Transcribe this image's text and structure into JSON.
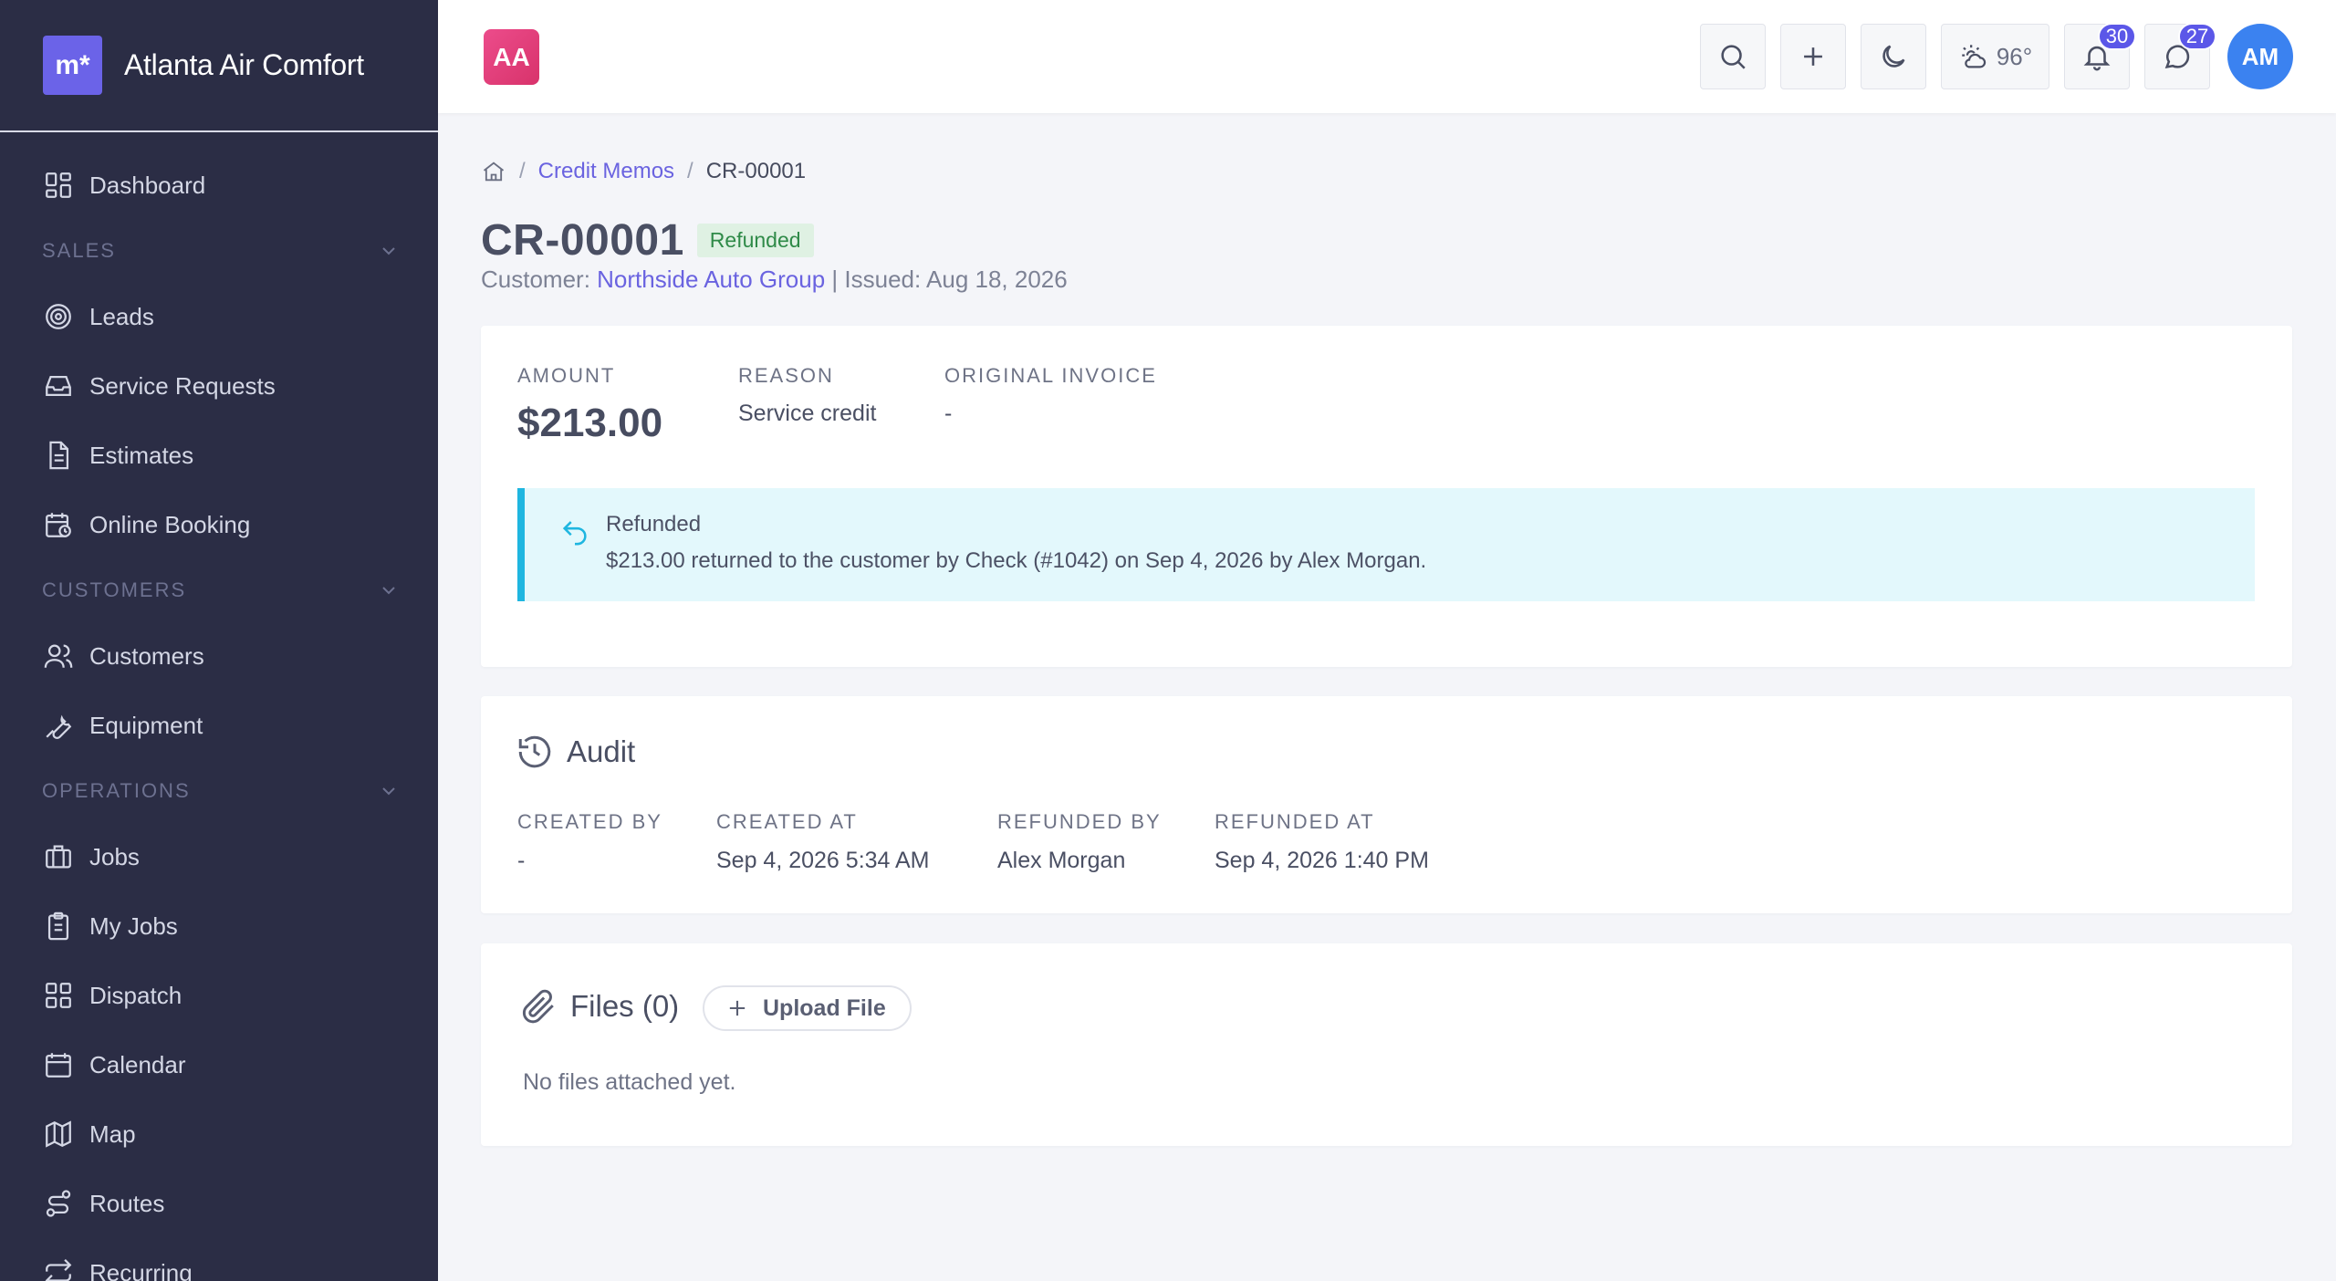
{
  "app": {
    "brand_mark": "m*",
    "company_name": "Atlanta Air Comfort",
    "company_initials": "AA"
  },
  "sidebar": {
    "items": [
      {
        "label": "Dashboard",
        "icon": "dashboard-icon"
      },
      {
        "section": "SALES"
      },
      {
        "label": "Leads",
        "icon": "target-icon"
      },
      {
        "label": "Service Requests",
        "icon": "inbox-icon"
      },
      {
        "label": "Estimates",
        "icon": "document-icon"
      },
      {
        "label": "Online Booking",
        "icon": "calendar-clock-icon"
      },
      {
        "section": "CUSTOMERS"
      },
      {
        "label": "Customers",
        "icon": "users-icon"
      },
      {
        "label": "Equipment",
        "icon": "wrench-icon"
      },
      {
        "section": "OPERATIONS"
      },
      {
        "label": "Jobs",
        "icon": "briefcase-icon"
      },
      {
        "label": "My Jobs",
        "icon": "clipboard-icon"
      },
      {
        "label": "Dispatch",
        "icon": "grid-icon"
      },
      {
        "label": "Calendar",
        "icon": "calendar-icon"
      },
      {
        "label": "Map",
        "icon": "map-icon"
      },
      {
        "label": "Routes",
        "icon": "route-icon"
      },
      {
        "label": "Recurring",
        "icon": "repeat-icon"
      }
    ]
  },
  "topbar": {
    "weather_temp": "96°",
    "notifications_count": "30",
    "messages_count": "27",
    "user_initials": "AM"
  },
  "breadcrumb": {
    "parent": "Credit Memos",
    "current": "CR-00001"
  },
  "memo": {
    "number": "CR-00001",
    "status": "Refunded",
    "customer_prefix": "Customer: ",
    "customer_name": "Northside Auto Group",
    "issued_text": " | Issued: Aug 18, 2026",
    "amount_label": "AMOUNT",
    "amount_value": "$213.00",
    "reason_label": "REASON",
    "reason_value": "Service credit",
    "invoice_label": "ORIGINAL INVOICE",
    "invoice_value": "-",
    "alert_title": "Refunded",
    "alert_text": "$213.00 returned to the customer by Check (#1042) on Sep 4, 2026 by Alex Morgan."
  },
  "audit": {
    "title": "Audit",
    "fields": [
      {
        "label": "CREATED BY",
        "value": "-"
      },
      {
        "label": "CREATED AT",
        "value": "Sep 4, 2026 5:34 AM"
      },
      {
        "label": "REFUNDED BY",
        "value": "Alex Morgan"
      },
      {
        "label": "REFUNDED AT",
        "value": "Sep 4, 2026 1:40 PM"
      }
    ]
  },
  "files": {
    "title": "Files (0)",
    "upload_label": "Upload File",
    "empty_text": "No files attached yet."
  },
  "colors": {
    "sidebar_bg": "#2b2d45",
    "accent": "#6a63e0",
    "refunded_badge": "#2f8a48",
    "alert_border": "#1fb6e0",
    "avatar": "#3b82f0"
  }
}
